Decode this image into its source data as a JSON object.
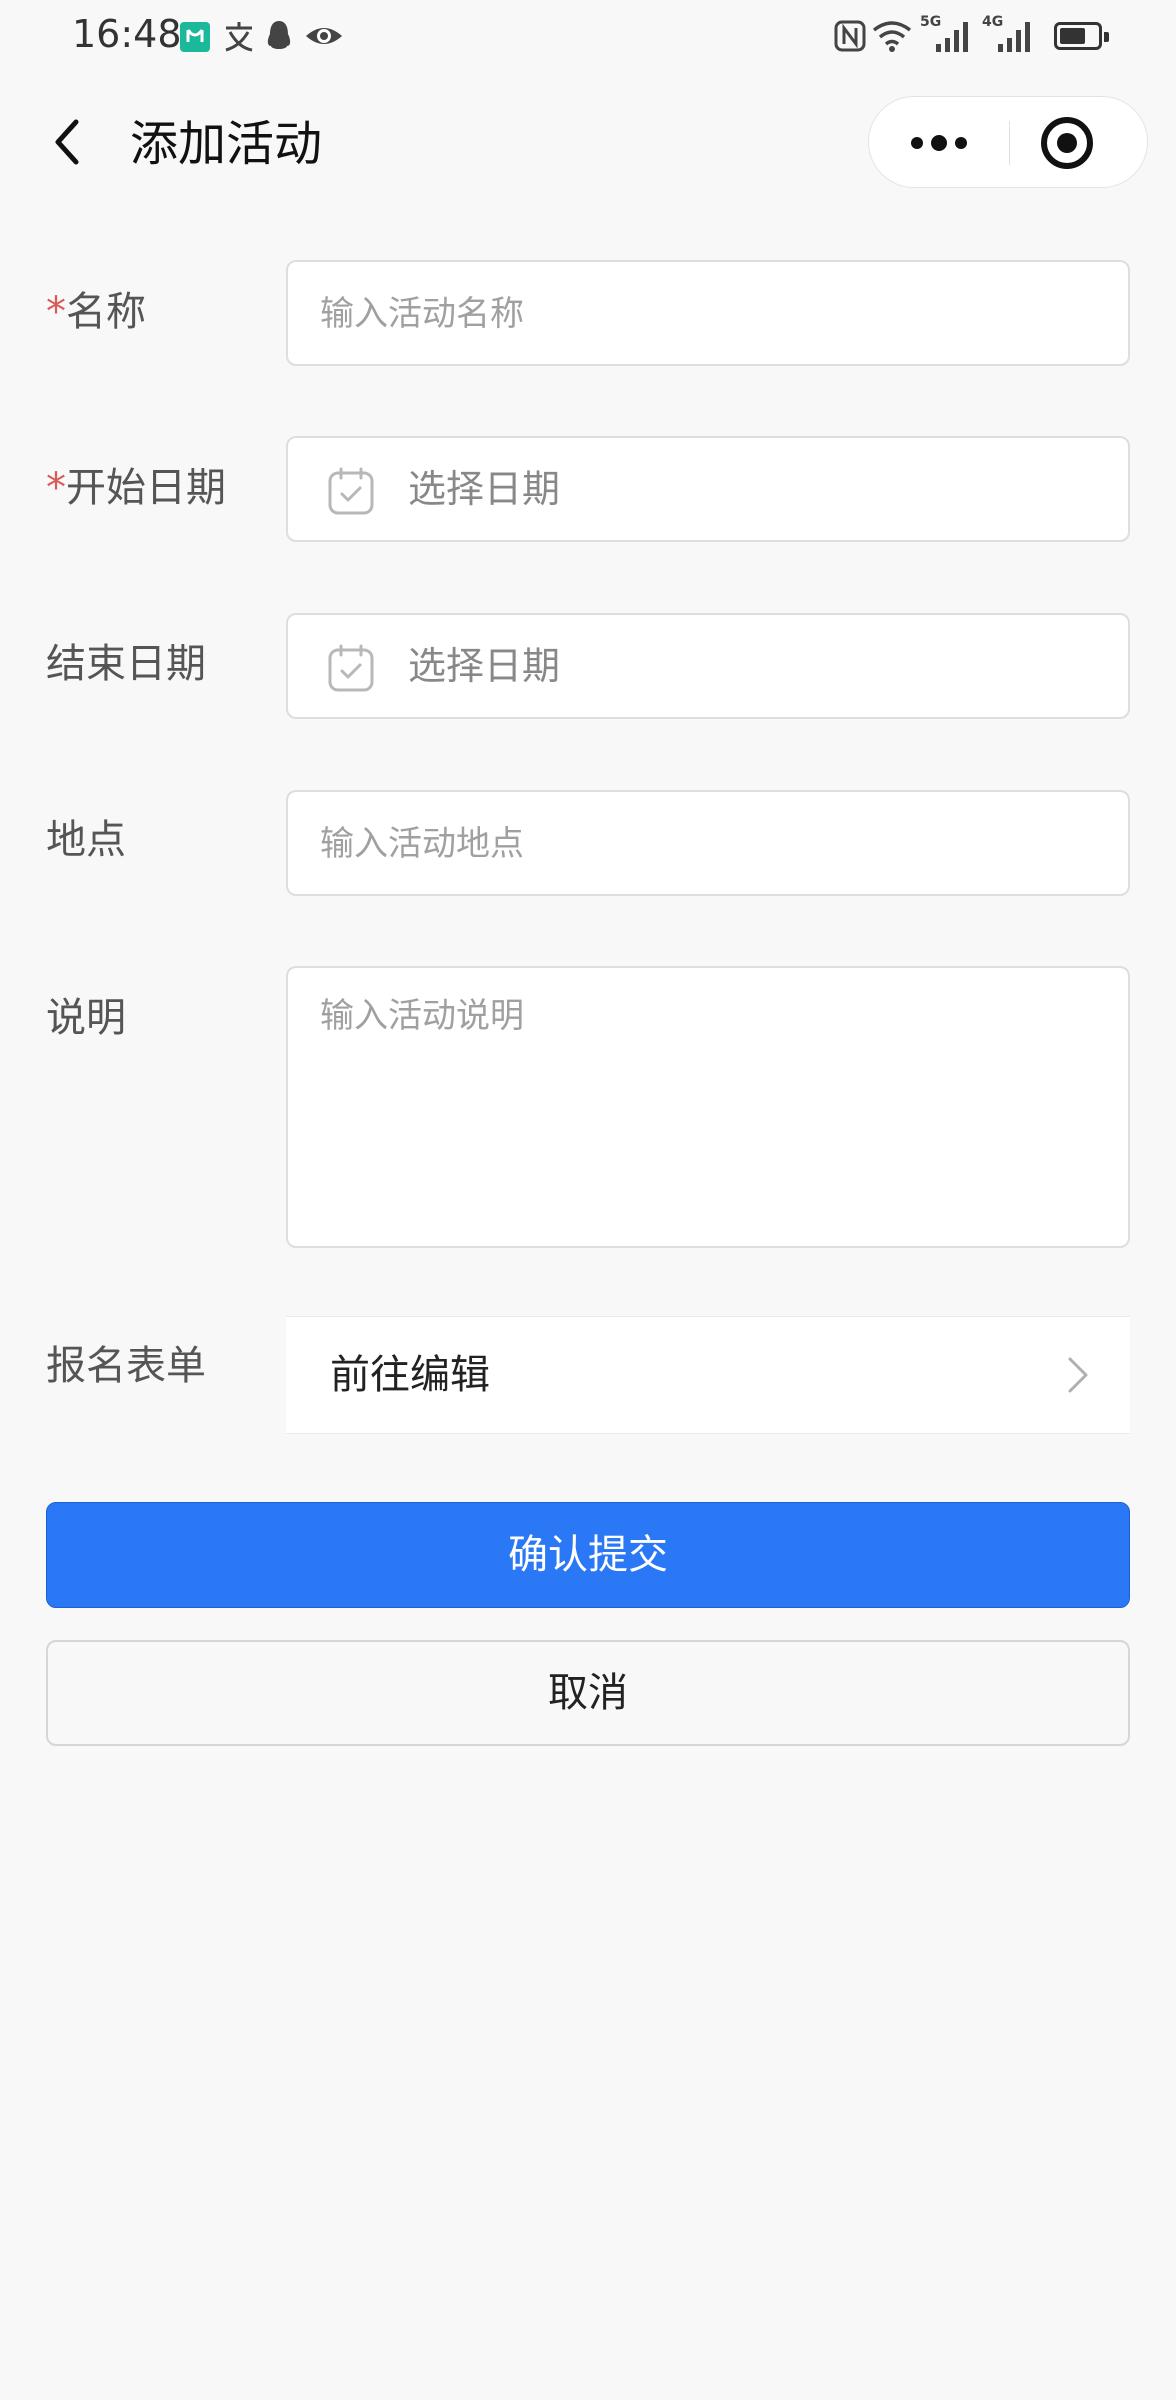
{
  "status_bar": {
    "time": "16:48",
    "left_icons": [
      "app-badge-icon",
      "translate-icon",
      "qq-icon",
      "eye-icon"
    ],
    "right_icons": [
      "nfc-icon",
      "wifi-icon",
      "signal-5g-icon",
      "signal-4g-icon",
      "battery-icon"
    ],
    "signal_5g": "5G",
    "signal_4g": "4G",
    "battery_level": 0.6
  },
  "nav": {
    "title": "添加活动",
    "back_icon": "chevron-left-icon",
    "more_icon": "more-dots-icon",
    "close_icon": "target-circle-icon"
  },
  "form": {
    "required_mark": "*",
    "name": {
      "label": "名称",
      "required": true,
      "placeholder": "输入活动名称",
      "value": ""
    },
    "start_date": {
      "label": "开始日期",
      "required": true,
      "text": "选择日期",
      "icon": "calendar-check-icon"
    },
    "end_date": {
      "label": "结束日期",
      "required": false,
      "text": "选择日期",
      "icon": "calendar-check-icon"
    },
    "location": {
      "label": "地点",
      "placeholder": "输入活动地点",
      "value": ""
    },
    "description": {
      "label": "说明",
      "placeholder": "输入活动说明",
      "value": ""
    },
    "signup_form": {
      "label": "报名表单",
      "link_text": "前往编辑",
      "icon": "chevron-right-icon"
    }
  },
  "actions": {
    "submit_label": "确认提交",
    "cancel_label": "取消"
  },
  "colors": {
    "primary": "#2b78f6",
    "required": "#d85b5b",
    "background": "#f8f8f8"
  }
}
